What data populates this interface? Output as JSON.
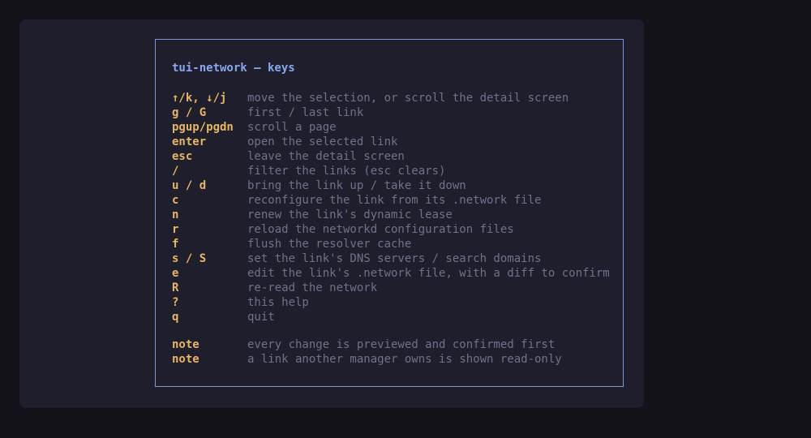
{
  "help": {
    "title": "tui-network — keys",
    "bindings": [
      {
        "key": "↑/k, ↓/j",
        "desc": "move the selection, or scroll the detail screen"
      },
      {
        "key": "g / G",
        "desc": "first / last link"
      },
      {
        "key": "pgup/pgdn",
        "desc": "scroll a page"
      },
      {
        "key": "enter",
        "desc": "open the selected link"
      },
      {
        "key": "esc",
        "desc": "leave the detail screen"
      },
      {
        "key": "/",
        "desc": "filter the links (esc clears)"
      },
      {
        "key": "u / d",
        "desc": "bring the link up / take it down"
      },
      {
        "key": "c",
        "desc": "reconfigure the link from its .network file"
      },
      {
        "key": "n",
        "desc": "renew the link's dynamic lease"
      },
      {
        "key": "r",
        "desc": "reload the networkd configuration files"
      },
      {
        "key": "f",
        "desc": "flush the resolver cache"
      },
      {
        "key": "s / S",
        "desc": "set the link's DNS servers / search domains"
      },
      {
        "key": "e",
        "desc": "edit the link's .network file, with a diff to confirm"
      },
      {
        "key": "R",
        "desc": "re-read the network"
      },
      {
        "key": "?",
        "desc": "this help"
      },
      {
        "key": "q",
        "desc": "quit"
      }
    ],
    "notes": [
      {
        "key": "note",
        "desc": "every change is previewed and confirmed first"
      },
      {
        "key": "note",
        "desc": "a link another manager owns is shown read-only"
      }
    ]
  },
  "colors": {
    "background": "#121218",
    "window": "#1e1e2c",
    "border": "#7f95d4",
    "title": "#8aa8ee",
    "key": "#e6b664",
    "description": "#6d738c"
  }
}
